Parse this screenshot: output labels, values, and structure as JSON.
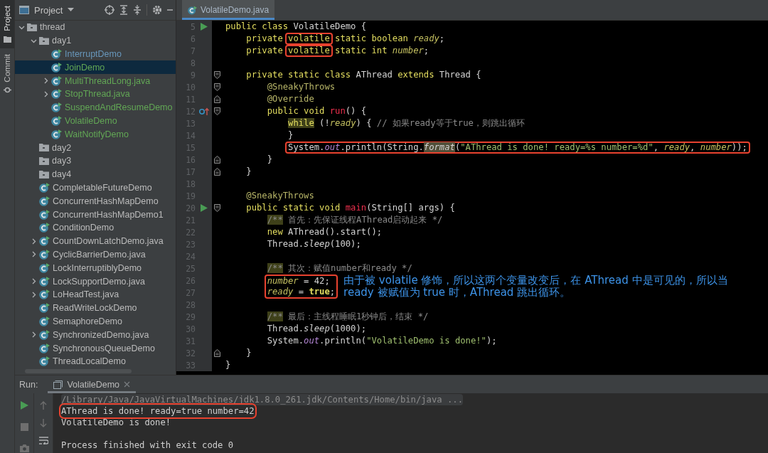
{
  "tool_strip": {
    "tabs": [
      {
        "label": "Project",
        "selected": true
      },
      {
        "label": "Commit",
        "selected": false
      }
    ]
  },
  "project_panel": {
    "title": "Project",
    "tree": [
      {
        "label": "thread",
        "kind": "folder",
        "expanded": true,
        "selected": false,
        "children": [
          {
            "label": "day1",
            "kind": "folder",
            "expanded": true,
            "selected": false,
            "children": [
              {
                "label": "InterruptDemo",
                "kind": "class",
                "color": "#6897bb",
                "selected": false
              },
              {
                "label": "JoinDemo",
                "kind": "class",
                "color": "#62a755",
                "selected": true
              },
              {
                "label": "MultiThreadLong.java",
                "kind": "class",
                "expanded": false,
                "color": "#62a755",
                "selected": false
              },
              {
                "label": "StopThread.java",
                "kind": "class",
                "expanded": false,
                "color": "#62a755",
                "selected": false
              },
              {
                "label": "SuspendAndResumeDemo",
                "kind": "class",
                "color": "#62a755",
                "selected": false
              },
              {
                "label": "VolatileDemo",
                "kind": "class",
                "color": "#62a755",
                "selected": false
              },
              {
                "label": "WaitNotifyDemo",
                "kind": "class",
                "color": "#62a755",
                "selected": false
              }
            ]
          },
          {
            "label": "day2",
            "kind": "folder",
            "selected": false
          },
          {
            "label": "day3",
            "kind": "folder",
            "selected": false
          },
          {
            "label": "day4",
            "kind": "folder",
            "selected": false
          },
          {
            "label": "CompletableFutureDemo",
            "kind": "class",
            "selected": false
          },
          {
            "label": "ConcurrentHashMapDemo",
            "kind": "class",
            "selected": false
          },
          {
            "label": "ConcurrentHashMapDemo1",
            "kind": "class",
            "selected": false
          },
          {
            "label": "ConditionDemo",
            "kind": "class",
            "selected": false
          },
          {
            "label": "CountDownLatchDemo.java",
            "kind": "class",
            "expanded": false,
            "selected": false
          },
          {
            "label": "CyclicBarrierDemo.java",
            "kind": "class",
            "expanded": false,
            "selected": false
          },
          {
            "label": "LockInterruptiblyDemo",
            "kind": "class",
            "selected": false
          },
          {
            "label": "LockSupportDemo.java",
            "kind": "class",
            "expanded": false,
            "selected": false
          },
          {
            "label": "LoHeadTest.java",
            "kind": "class",
            "expanded": false,
            "selected": false
          },
          {
            "label": "ReadWriteLockDemo",
            "kind": "class",
            "selected": false
          },
          {
            "label": "SemaphoreDemo",
            "kind": "class",
            "selected": false
          },
          {
            "label": "SynchronizedDemo.java",
            "kind": "class",
            "expanded": false,
            "selected": false
          },
          {
            "label": "SynchronousQueueDemo",
            "kind": "class",
            "selected": false
          },
          {
            "label": "ThreadLocalDemo",
            "kind": "class",
            "selected": false
          }
        ]
      }
    ]
  },
  "editor": {
    "tabs": [
      {
        "label": "VolatileDemo.java",
        "selected": true
      }
    ],
    "lines": [
      {
        "kind": "code",
        "n": "5",
        "gutter": {
          "kind": "run"
        },
        "tokens": [
          {
            "kind": "kw",
            "text": "public class "
          },
          {
            "kind": "plain",
            "text": "VolatileDemo {"
          }
        ]
      },
      {
        "kind": "code",
        "n": "6",
        "tokens": [
          {
            "kind": "kw",
            "text": "    private "
          },
          {
            "kind": "kw",
            "text": "volatile",
            "boxed": true
          },
          {
            "kind": "kw",
            "text": " static boolean "
          },
          {
            "kind": "field",
            "text": "ready"
          },
          {
            "kind": "plain",
            "text": ";"
          }
        ]
      },
      {
        "kind": "code",
        "n": "7",
        "tokens": [
          {
            "kind": "kw",
            "text": "    private "
          },
          {
            "kind": "kw",
            "text": "volatile",
            "boxed": true
          },
          {
            "kind": "kw",
            "text": " static int "
          },
          {
            "kind": "field",
            "text": "number"
          },
          {
            "kind": "plain",
            "text": ";"
          }
        ]
      },
      {
        "kind": "code",
        "n": "8"
      },
      {
        "kind": "code",
        "n": "9",
        "fold": {
          "kind": "open"
        },
        "tokens": [
          {
            "kind": "kw",
            "text": "    private static class "
          },
          {
            "kind": "plain",
            "text": "AThread "
          },
          {
            "kind": "kw",
            "text": "extends "
          },
          {
            "kind": "plain",
            "text": "Thread {"
          }
        ]
      },
      {
        "kind": "code",
        "n": "10",
        "fold": {
          "kind": "open"
        },
        "tokens": [
          {
            "kind": "anno",
            "text": "        @SneakyThrows"
          }
        ]
      },
      {
        "kind": "code",
        "n": "11",
        "fold": {
          "kind": "close"
        },
        "tokens": [
          {
            "kind": "anno",
            "text": "        @Override"
          }
        ]
      },
      {
        "kind": "code",
        "n": "12",
        "gutter": {
          "kind": "override"
        },
        "fold": {
          "kind": "open"
        },
        "tokens": [
          {
            "kind": "kw",
            "text": "        public void "
          },
          {
            "kind": "decl",
            "text": "run"
          },
          {
            "kind": "plain",
            "text": "() {"
          }
        ]
      },
      {
        "kind": "code",
        "n": "13",
        "tokens": [
          {
            "kind": "hl_kw",
            "text": "            while"
          },
          {
            "kind": "plain",
            "text": " (!"
          },
          {
            "kind": "field",
            "text": "ready"
          },
          {
            "kind": "plain",
            "text": ") { "
          },
          {
            "kind": "comment",
            "text": "// 如果ready等于true，则跳出循环"
          }
        ]
      },
      {
        "kind": "code",
        "n": "14",
        "tokens": [
          {
            "kind": "plain",
            "text": "            }"
          }
        ]
      },
      {
        "kind": "code",
        "n": "15",
        "tokens": [
          {
            "kind": "plain",
            "text": "            System.",
            "boxed": true
          },
          {
            "kind": "static_field",
            "text": "out",
            "boxed": true
          },
          {
            "kind": "plain",
            "text": ".println(String.",
            "boxed": true
          },
          {
            "kind": "hl_method",
            "text": "format",
            "boxed": true
          },
          {
            "kind": "plain",
            "text": "(",
            "boxed": true
          },
          {
            "kind": "string",
            "text": "\"AThread is done! ready=%s number=%d\"",
            "boxed": true
          },
          {
            "kind": "plain",
            "text": ", ",
            "boxed": true
          },
          {
            "kind": "field",
            "text": "ready",
            "boxed": true
          },
          {
            "kind": "plain",
            "text": ", ",
            "boxed": true
          },
          {
            "kind": "field",
            "text": "number",
            "boxed": true
          },
          {
            "kind": "plain",
            "text": "));",
            "boxed": true
          }
        ]
      },
      {
        "kind": "code",
        "n": "16",
        "fold": {
          "kind": "close"
        },
        "tokens": [
          {
            "kind": "plain",
            "text": "        }"
          }
        ]
      },
      {
        "kind": "code",
        "n": "17",
        "fold": {
          "kind": "close"
        },
        "tokens": [
          {
            "kind": "plain",
            "text": "    }"
          }
        ]
      },
      {
        "kind": "code",
        "n": "18"
      },
      {
        "kind": "code",
        "n": "19",
        "tokens": [
          {
            "kind": "anno",
            "text": "    @SneakyThrows"
          }
        ]
      },
      {
        "kind": "code",
        "n": "20",
        "gutter": {
          "kind": "run"
        },
        "fold": {
          "kind": "open"
        },
        "tokens": [
          {
            "kind": "kw",
            "text": "    public static void "
          },
          {
            "kind": "decl",
            "text": "main"
          },
          {
            "kind": "plain",
            "text": "(String[] args) {"
          }
        ]
      },
      {
        "kind": "code",
        "n": "21",
        "tokens": [
          {
            "kind": "doc_mark",
            "text": "        /**"
          },
          {
            "kind": "comment",
            "text": " 首先：先保证线程AThread启动起来 */"
          }
        ]
      },
      {
        "kind": "code",
        "n": "22",
        "tokens": [
          {
            "kind": "kw",
            "text": "        new "
          },
          {
            "kind": "plain",
            "text": "AThread().start();"
          }
        ]
      },
      {
        "kind": "code",
        "n": "23",
        "tokens": [
          {
            "kind": "plain",
            "text": "        Thread."
          },
          {
            "kind": "static",
            "text": "sleep"
          },
          {
            "kind": "plain",
            "text": "(100);"
          }
        ]
      },
      {
        "kind": "code",
        "n": "24"
      },
      {
        "kind": "code",
        "n": "25",
        "tokens": [
          {
            "kind": "doc_mark",
            "text": "        /**"
          },
          {
            "kind": "comment",
            "text": " 其次：赋值number和ready */"
          }
        ]
      },
      {
        "kind": "callout",
        "lines": [
          {
            "n": "26",
            "tokens": [
              {
                "kind": "field",
                "text": "number"
              },
              {
                "kind": "plain",
                "text": " = 42;"
              }
            ]
          },
          {
            "n": "27",
            "tokens": [
              {
                "kind": "field",
                "text": "ready"
              },
              {
                "kind": "plain",
                "text": " = "
              },
              {
                "kind": "bold_kw",
                "text": "true"
              },
              {
                "kind": "plain",
                "text": ";"
              }
            ]
          }
        ],
        "note": "由于被 volatile 修饰，所以这两个变量改变后，在 AThread 中是可见的，所以当 ready 被赋值为 true 时，AThread 跳出循环。"
      },
      {
        "kind": "code",
        "n": "28"
      },
      {
        "kind": "code",
        "n": "29",
        "tokens": [
          {
            "kind": "doc_mark",
            "text": "        /**"
          },
          {
            "kind": "comment",
            "text": " 最后：主线程睡眠1秒钟后，结束 */"
          }
        ]
      },
      {
        "kind": "code",
        "n": "30",
        "tokens": [
          {
            "kind": "plain",
            "text": "        Thread."
          },
          {
            "kind": "static",
            "text": "sleep"
          },
          {
            "kind": "plain",
            "text": "(1000);"
          }
        ]
      },
      {
        "kind": "code",
        "n": "31",
        "tokens": [
          {
            "kind": "plain",
            "text": "        System."
          },
          {
            "kind": "static_field",
            "text": "out"
          },
          {
            "kind": "plain",
            "text": ".println("
          },
          {
            "kind": "string",
            "text": "\"VolatileDemo is done!\""
          },
          {
            "kind": "plain",
            "text": ");"
          }
        ]
      },
      {
        "kind": "code",
        "n": "32",
        "fold": {
          "kind": "close"
        },
        "tokens": [
          {
            "kind": "plain",
            "text": "    }"
          }
        ]
      },
      {
        "kind": "code",
        "n": "33",
        "tokens": [
          {
            "kind": "plain",
            "text": "}"
          }
        ]
      }
    ]
  },
  "run_panel": {
    "label": "Run:",
    "tabs": [
      {
        "label": "VolatileDemo",
        "selected": true
      }
    ],
    "output": [
      {
        "kind": "command",
        "text": "/Library/Java/JavaVirtualMachines/jdk1.8.0_261.jdk/Contents/Home/bin/java ...",
        "boxed": false
      },
      {
        "kind": "stdout",
        "text": "AThread is done! ready=true number=42",
        "boxed": true
      },
      {
        "kind": "stdout",
        "text": "VolatileDemo is done!",
        "boxed": false
      },
      {
        "kind": "exit",
        "text": "Process finished with exit code 0",
        "boxed": false
      }
    ]
  }
}
